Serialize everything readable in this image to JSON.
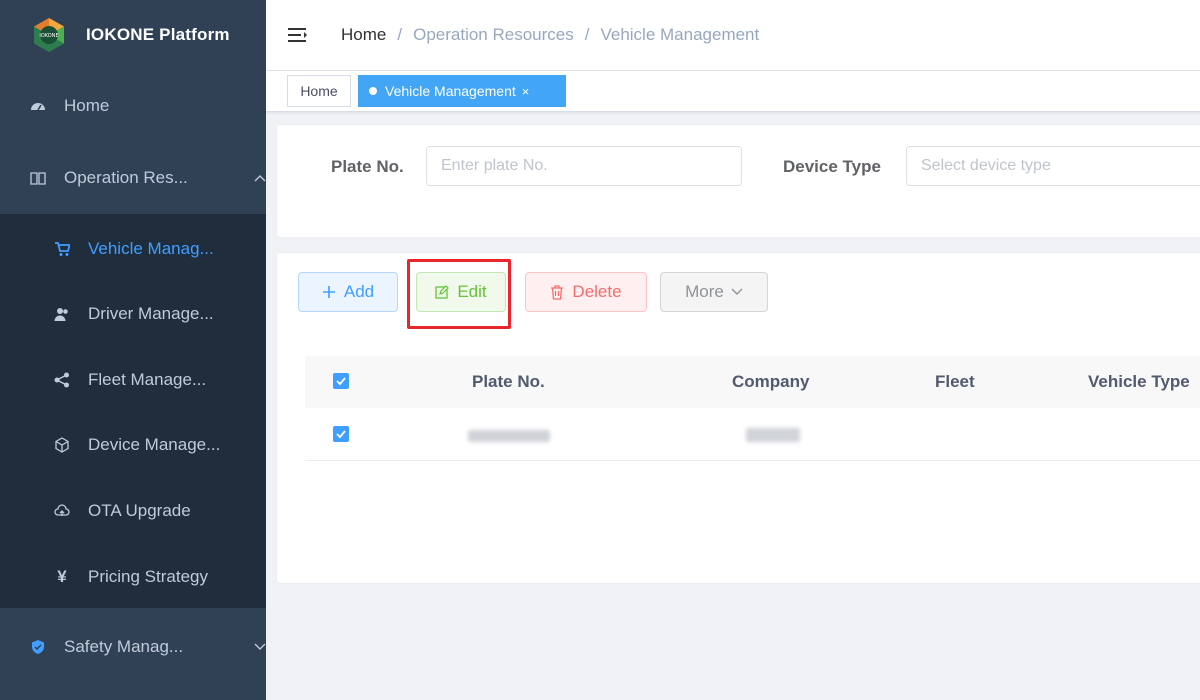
{
  "app": {
    "title": "IOKONE Platform"
  },
  "sidebar": {
    "home": "Home",
    "operation": "Operation Res...",
    "items": [
      {
        "label": "Vehicle Manag...",
        "icon": "cart-icon",
        "active": true
      },
      {
        "label": "Driver Manage...",
        "icon": "users-icon",
        "active": false
      },
      {
        "label": "Fleet Manage...",
        "icon": "share-icon",
        "active": false
      },
      {
        "label": "Device Manage...",
        "icon": "cube-icon",
        "active": false
      },
      {
        "label": "OTA Upgrade",
        "icon": "cloud-icon",
        "active": false
      },
      {
        "label": "Pricing Strategy",
        "icon": "yen-icon",
        "active": false
      }
    ],
    "safety": "Safety Manag..."
  },
  "header": {
    "breadcrumb": [
      "Home",
      "Operation Resources",
      "Vehicle Management"
    ],
    "separator": "/"
  },
  "tags": {
    "home": "Home",
    "active": "Vehicle Management"
  },
  "search": {
    "plate_label": "Plate No.",
    "plate_placeholder": "Enter plate No.",
    "device_label": "Device Type",
    "device_placeholder": "Select device type"
  },
  "toolbar": {
    "add": "Add",
    "edit": "Edit",
    "delete": "Delete",
    "more": "More"
  },
  "table": {
    "columns": [
      "Plate No.",
      "Company",
      "Fleet",
      "Vehicle Type"
    ]
  },
  "colors": {
    "sidebar_bg": "#304156",
    "submenu_bg": "#1f2d3d",
    "primary": "#409eff",
    "success": "#67c23a",
    "danger": "#f56c6c",
    "highlight": "#e8262b"
  }
}
